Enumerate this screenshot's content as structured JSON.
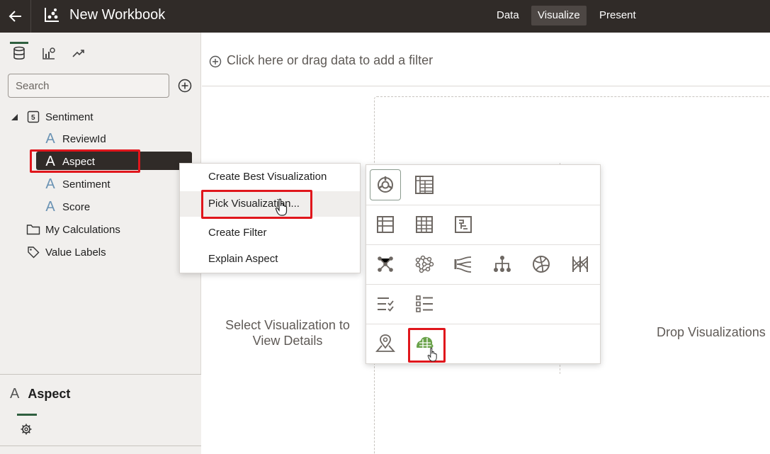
{
  "header": {
    "title": "New Workbook",
    "tabs": [
      {
        "label": "Data",
        "active": false
      },
      {
        "label": "Visualize",
        "active": true
      },
      {
        "label": "Present",
        "active": false
      }
    ]
  },
  "left_panel": {
    "search_placeholder": "Search",
    "tree": [
      {
        "label": "Sentiment",
        "type": "dataset",
        "expanded": true
      },
      {
        "label": "ReviewId",
        "type": "attribute"
      },
      {
        "label": "Aspect",
        "type": "attribute",
        "selected": true
      },
      {
        "label": "Sentiment",
        "type": "attribute"
      },
      {
        "label": "Score",
        "type": "attribute"
      },
      {
        "label": "My Calculations",
        "type": "folder"
      },
      {
        "label": "Value Labels",
        "type": "tag"
      }
    ],
    "properties": {
      "title": "Aspect"
    }
  },
  "canvas": {
    "filter_prompt": "Click here or drag data to add a filter",
    "select_message": "Select Visualization to View Details",
    "drop_message": "Drop Visualizations"
  },
  "context_menu": {
    "items": [
      {
        "label": "Create Best Visualization"
      },
      {
        "label": "Pick Visualization..."
      },
      {
        "label": "Create Filter"
      },
      {
        "label": "Explain Aspect"
      }
    ]
  },
  "viz_picker": {
    "rows": [
      [
        "auto-viz-icon",
        "pivot-table-icon"
      ],
      [
        "table-icon",
        "grid-icon",
        "tile-icon"
      ],
      [
        "network-icon",
        "graph-icon",
        "sankey-icon",
        "tree-diagram-icon",
        "chord-icon",
        "parallel-coordinates-icon"
      ],
      [
        "checklist-icon",
        "list-icon"
      ],
      [
        "map-icon",
        "word-cloud-icon"
      ]
    ]
  },
  "colors": {
    "header_bg": "#302b28",
    "panel_bg": "#f1efed",
    "accent_green": "#2f5f3f",
    "highlight_red": "#e0161c",
    "icon_gray": "#6d6762",
    "attribute_blue": "#6b93b4",
    "wordcloud_green": "#6aa24a"
  }
}
